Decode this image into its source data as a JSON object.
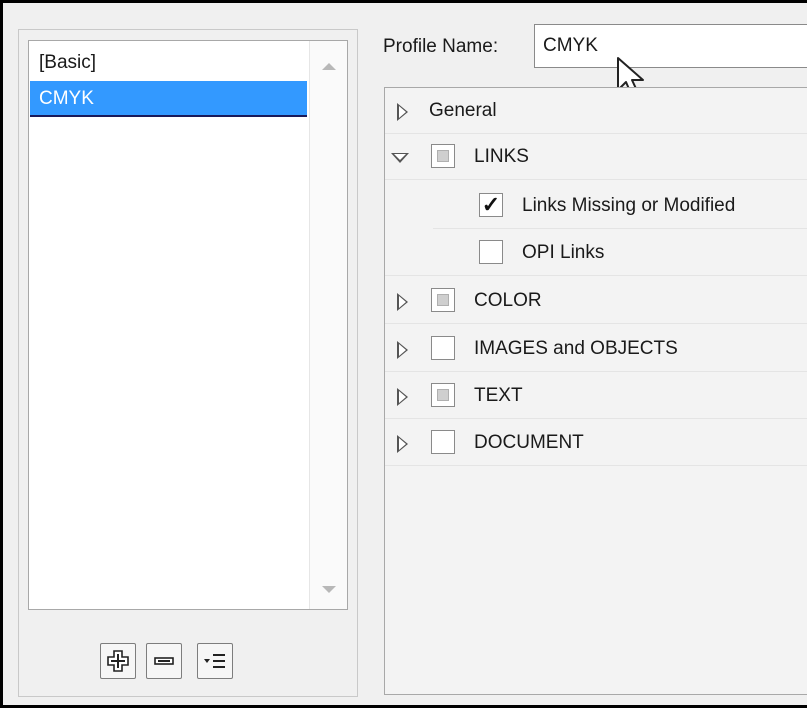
{
  "profiles": {
    "items": [
      {
        "label": "[Basic]",
        "selected": false
      },
      {
        "label": "CMYK",
        "selected": true
      }
    ]
  },
  "toolbar": {
    "add_icon": "plus-icon",
    "remove_icon": "minus-icon",
    "menu_icon": "list-menu-icon"
  },
  "profile_name": {
    "label": "Profile Name:",
    "value": "CMYK"
  },
  "tree": {
    "general": {
      "label": "General",
      "expanded": false
    },
    "links": {
      "label": "LINKS",
      "expanded": true,
      "state": "mixed"
    },
    "links_missing": {
      "label": "Links Missing or Modified",
      "checked": true
    },
    "opi_links": {
      "label": "OPI Links",
      "checked": false
    },
    "color": {
      "label": "COLOR",
      "expanded": false,
      "state": "mixed"
    },
    "images": {
      "label": "IMAGES and OBJECTS",
      "expanded": false,
      "state": "unchecked"
    },
    "text": {
      "label": "TEXT",
      "expanded": false,
      "state": "mixed"
    },
    "document": {
      "label": "DOCUMENT",
      "expanded": false,
      "state": "unchecked"
    }
  },
  "colors": {
    "selection": "#3399ff",
    "panel_bg": "#f0f0f0"
  }
}
